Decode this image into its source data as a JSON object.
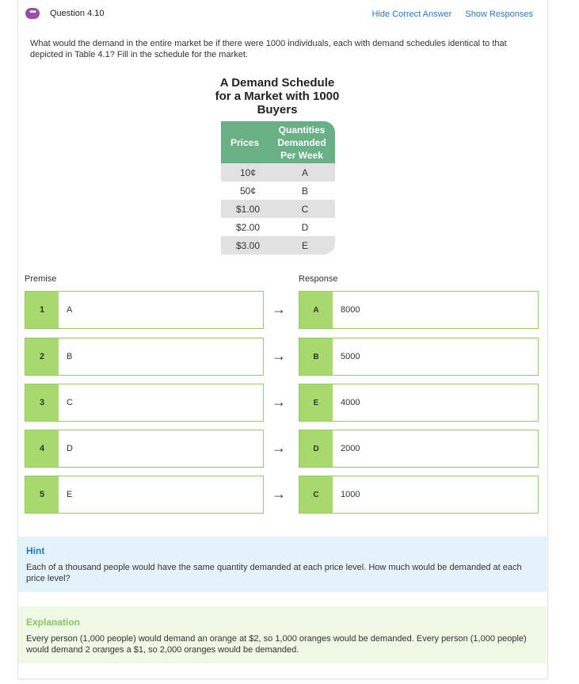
{
  "header": {
    "question_title": "Question 4.10",
    "hide_answer_link": "Hide Correct Answer",
    "show_responses_link": "Show Responses"
  },
  "question": {
    "text": "What would the demand in the entire market be if there were 1000 individuals, each with demand schedules identical to that depicted in Table 4.1? Fill in the schedule for the market."
  },
  "demand_table": {
    "title": "A Demand Schedule for a Market with 1000 Buyers",
    "header_prices": "Prices",
    "header_quantities": "Quantities Demanded Per Week",
    "rows": [
      {
        "price": "10¢",
        "qty": "A"
      },
      {
        "price": "50¢",
        "qty": "B"
      },
      {
        "price": "$1.00",
        "qty": "C"
      },
      {
        "price": "$2.00",
        "qty": "D"
      },
      {
        "price": "$3.00",
        "qty": "E"
      }
    ]
  },
  "matching": {
    "premise_label": "Premise",
    "response_label": "Response",
    "arrow": "→",
    "premises": [
      {
        "num": "1",
        "text": "A"
      },
      {
        "num": "2",
        "text": "B"
      },
      {
        "num": "3",
        "text": "C"
      },
      {
        "num": "4",
        "text": "D"
      },
      {
        "num": "5",
        "text": "E"
      }
    ],
    "responses": [
      {
        "letter": "A",
        "text": "8000"
      },
      {
        "letter": "B",
        "text": "5000"
      },
      {
        "letter": "E",
        "text": "4000"
      },
      {
        "letter": "D",
        "text": "2000"
      },
      {
        "letter": "C",
        "text": "1000"
      }
    ]
  },
  "hint": {
    "heading": "Hint",
    "body": "Each of a thousand people would have the same quantity demanded at each price level. How much would be demanded at each price level?"
  },
  "explanation": {
    "heading": "Explanation",
    "body": "Every person (1,000 people) would demand an orange at $2, so 1,000 oranges would be demanded. Every person (1,000 people) would demand 2 oranges a $1, so 2,000 oranges would be demanded."
  },
  "colors": {
    "accent_green": "#a7d96d",
    "table_header_green": "#6ab086",
    "link_blue": "#2a7bbf",
    "question_icon_purple": "#9b4ea8"
  }
}
